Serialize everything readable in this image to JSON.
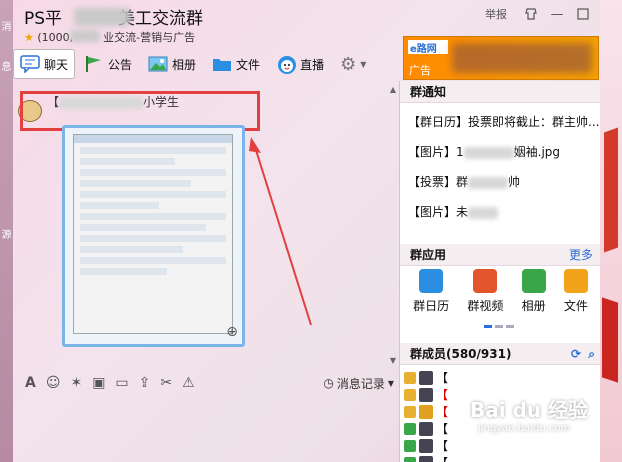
{
  "left_strip": {
    "chars": [
      "消",
      "息",
      "源"
    ]
  },
  "header": {
    "title_left": "PS平",
    "title_right": "美工交流群",
    "subtitle_left": "(1000,",
    "subtitle_right": "业交流-营销与广告",
    "report": "举报"
  },
  "toolbar": {
    "chat": "聊天",
    "notice": "公告",
    "album": "相册",
    "file": "文件",
    "live": "直播"
  },
  "ad": {
    "logo": "e路网",
    "tag": "广告"
  },
  "chat": {
    "message_prefix": "【",
    "message_suffix": "小学生"
  },
  "chat_tools": {
    "history": "消息记录"
  },
  "panel": {
    "notice_title": "群通知",
    "notices": [
      {
        "prefix": "【群日历】",
        "text": "投票即将截止：群主帅..."
      },
      {
        "prefix": "【图片】",
        "text": "1",
        "suffix": "姻袖.jpg"
      },
      {
        "prefix": "【投票】",
        "text": "群",
        "suffix": "帅"
      },
      {
        "prefix": "【图片】",
        "text": "未"
      }
    ],
    "apps_title": "群应用",
    "apps_more": "更多",
    "apps": [
      {
        "label": "群日历",
        "color": "#2a8fe0"
      },
      {
        "label": "群视频",
        "color": "#e3552d"
      },
      {
        "label": "相册",
        "color": "#3aa64a"
      },
      {
        "label": "文件",
        "color": "#f2a21b"
      }
    ],
    "members_title": "群成员(580/931)"
  },
  "watermark": {
    "brand": "Bai du 经验",
    "url": "jingyan.baidu.com"
  }
}
